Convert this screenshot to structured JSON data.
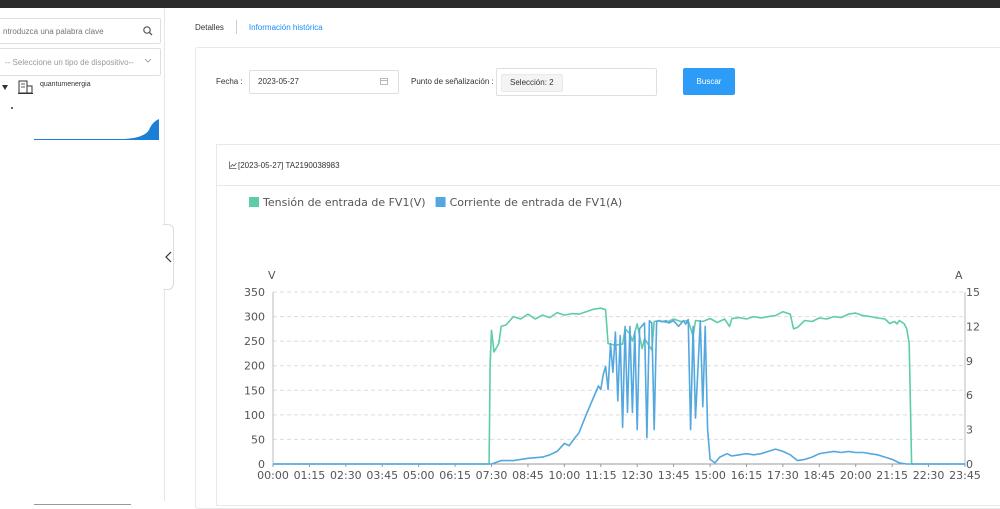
{
  "sidebar": {
    "search_placeholder": "ntroduzca una palabra clave",
    "device_type_placeholder": "-- Seleccione un tipo de dispositivo--",
    "tree_node": "quantumenergia"
  },
  "tabs": {
    "details": "Detalles",
    "history": "Información histórica"
  },
  "filters": {
    "date_label": "Fecha :",
    "date_value": "2023-05-27",
    "point_label": "Punto de señalización :",
    "selection_tag": "Selección: 2",
    "search_button": "Buscar"
  },
  "chart_header": {
    "title": "[2023-05-27] TA2190038983"
  },
  "colors": {
    "accent": "#2d9cf7",
    "link": "#1a8cff",
    "series_voltage": "#5ecca8",
    "series_current": "#53a8df"
  },
  "chart_data": {
    "type": "line",
    "legend": [
      {
        "name": "Tensión de entrada de FV1(V)",
        "color": "#5ecca8"
      },
      {
        "name": "Corriente de entrada de FV1(A)",
        "color": "#53a8df"
      }
    ],
    "legend_position": "top-left",
    "x_ticks": [
      "00:00",
      "01:15",
      "02:30",
      "03:45",
      "05:00",
      "06:15",
      "07:30",
      "08:45",
      "10:00",
      "11:15",
      "12:30",
      "13:45",
      "15:00",
      "16:15",
      "17:30",
      "18:45",
      "20:00",
      "21:15",
      "22:30",
      "23:45"
    ],
    "y_left": {
      "label": "V",
      "ticks": [
        0,
        50,
        100,
        150,
        200,
        250,
        300,
        350
      ],
      "range": [
        0,
        350
      ]
    },
    "y_right": {
      "label": "A",
      "ticks": [
        0,
        3,
        6,
        9,
        12,
        15
      ],
      "range": [
        0,
        15
      ]
    },
    "grid": "horizontal dashed",
    "series": [
      {
        "name": "Tensión de entrada de FV1(V)",
        "axis": "left",
        "points": [
          [
            "00:00",
            0
          ],
          [
            "07:25",
            0
          ],
          [
            "07:27",
            200
          ],
          [
            "07:30",
            272
          ],
          [
            "07:35",
            228
          ],
          [
            "07:45",
            245
          ],
          [
            "07:50",
            280
          ],
          [
            "08:00",
            283
          ],
          [
            "08:15",
            300
          ],
          [
            "08:30",
            295
          ],
          [
            "08:45",
            305
          ],
          [
            "09:00",
            295
          ],
          [
            "09:15",
            303
          ],
          [
            "09:30",
            298
          ],
          [
            "09:45",
            308
          ],
          [
            "10:00",
            303
          ],
          [
            "10:15",
            306
          ],
          [
            "10:30",
            305
          ],
          [
            "10:45",
            310
          ],
          [
            "11:00",
            315
          ],
          [
            "11:15",
            317
          ],
          [
            "11:25",
            314
          ],
          [
            "11:30",
            245
          ],
          [
            "11:45",
            242
          ],
          [
            "12:00",
            244
          ],
          [
            "12:05",
            275
          ],
          [
            "12:15",
            265
          ],
          [
            "12:20",
            250
          ],
          [
            "12:30",
            285
          ],
          [
            "12:40",
            235
          ],
          [
            "12:45",
            255
          ],
          [
            "13:00",
            232
          ],
          [
            "13:05",
            290
          ],
          [
            "13:15",
            292
          ],
          [
            "13:30",
            288
          ],
          [
            "13:45",
            295
          ],
          [
            "14:00",
            290
          ],
          [
            "14:15",
            292
          ],
          [
            "14:25",
            260
          ],
          [
            "14:30",
            292
          ],
          [
            "14:45",
            290
          ],
          [
            "15:00",
            296
          ],
          [
            "15:15",
            288
          ],
          [
            "15:30",
            295
          ],
          [
            "15:40",
            280
          ],
          [
            "15:45",
            296
          ],
          [
            "16:00",
            298
          ],
          [
            "16:15",
            295
          ],
          [
            "16:30",
            300
          ],
          [
            "16:45",
            297
          ],
          [
            "17:00",
            300
          ],
          [
            "17:15",
            302
          ],
          [
            "17:30",
            310
          ],
          [
            "17:45",
            305
          ],
          [
            "17:52",
            275
          ],
          [
            "18:00",
            278
          ],
          [
            "18:15",
            292
          ],
          [
            "18:30",
            290
          ],
          [
            "18:45",
            297
          ],
          [
            "19:00",
            295
          ],
          [
            "19:15",
            300
          ],
          [
            "19:30",
            298
          ],
          [
            "19:45",
            305
          ],
          [
            "20:00",
            307
          ],
          [
            "20:15",
            302
          ],
          [
            "20:30",
            300
          ],
          [
            "20:45",
            297
          ],
          [
            "21:00",
            295
          ],
          [
            "21:10",
            286
          ],
          [
            "21:20",
            290
          ],
          [
            "21:25",
            285
          ],
          [
            "21:30",
            292
          ],
          [
            "21:40",
            285
          ],
          [
            "21:45",
            275
          ],
          [
            "21:50",
            245
          ],
          [
            "21:55",
            0
          ],
          [
            "23:45",
            0
          ]
        ]
      },
      {
        "name": "Corriente de entrada de FV1(A)",
        "axis": "right",
        "points": [
          [
            "00:00",
            0
          ],
          [
            "07:30",
            0
          ],
          [
            "07:50",
            0.3
          ],
          [
            "08:15",
            0.3
          ],
          [
            "08:45",
            0.5
          ],
          [
            "09:15",
            0.6
          ],
          [
            "09:30",
            0.8
          ],
          [
            "09:45",
            1.1
          ],
          [
            "10:00",
            1.8
          ],
          [
            "10:10",
            1.6
          ],
          [
            "10:20",
            2.2
          ],
          [
            "10:30",
            2.7
          ],
          [
            "10:45",
            4.3
          ],
          [
            "11:00",
            5.8
          ],
          [
            "11:10",
            6.8
          ],
          [
            "11:15",
            6.5
          ],
          [
            "11:20",
            7.8
          ],
          [
            "11:25",
            8.5
          ],
          [
            "11:30",
            6.5
          ],
          [
            "11:35",
            10.5
          ],
          [
            "11:40",
            8.0
          ],
          [
            "11:45",
            11.5
          ],
          [
            "11:50",
            5.5
          ],
          [
            "11:55",
            11.2
          ],
          [
            "12:00",
            3.2
          ],
          [
            "12:05",
            12.0
          ],
          [
            "12:10",
            4.5
          ],
          [
            "12:15",
            12.0
          ],
          [
            "12:20",
            4.5
          ],
          [
            "12:25",
            11.5
          ],
          [
            "12:30",
            3.0
          ],
          [
            "12:35",
            11.8
          ],
          [
            "12:45",
            12.3
          ],
          [
            "12:50",
            2.3
          ],
          [
            "12:55",
            12.5
          ],
          [
            "13:00",
            12.3
          ],
          [
            "13:05",
            3.0
          ],
          [
            "13:10",
            12.4
          ],
          [
            "13:15",
            12.5
          ],
          [
            "13:20",
            12.4
          ],
          [
            "13:30",
            12.5
          ],
          [
            "13:35",
            12.3
          ],
          [
            "13:45",
            12.5
          ],
          [
            "13:55",
            12.0
          ],
          [
            "14:05",
            12.5
          ],
          [
            "14:10",
            12.2
          ],
          [
            "14:15",
            12.6
          ],
          [
            "14:20",
            3.0
          ],
          [
            "14:25",
            12.0
          ],
          [
            "14:30",
            4.0
          ],
          [
            "14:40",
            12.5
          ],
          [
            "14:45",
            5.0
          ],
          [
            "14:50",
            12.0
          ],
          [
            "14:55",
            3.0
          ],
          [
            "15:00",
            0.4
          ],
          [
            "15:10",
            0.1
          ],
          [
            "15:20",
            0.6
          ],
          [
            "15:35",
            0.9
          ],
          [
            "15:45",
            0.7
          ],
          [
            "16:00",
            0.8
          ],
          [
            "16:15",
            0.9
          ],
          [
            "16:30",
            0.8
          ],
          [
            "16:45",
            0.9
          ],
          [
            "17:00",
            1.1
          ],
          [
            "17:15",
            1.3
          ],
          [
            "17:30",
            1.1
          ],
          [
            "17:45",
            0.8
          ],
          [
            "18:00",
            0.3
          ],
          [
            "18:15",
            0.4
          ],
          [
            "18:30",
            0.6
          ],
          [
            "18:45",
            0.9
          ],
          [
            "19:00",
            1.0
          ],
          [
            "19:15",
            1.1
          ],
          [
            "19:30",
            1.0
          ],
          [
            "19:45",
            1.1
          ],
          [
            "20:00",
            1.0
          ],
          [
            "20:15",
            1.0
          ],
          [
            "20:30",
            0.9
          ],
          [
            "20:45",
            0.8
          ],
          [
            "21:00",
            0.6
          ],
          [
            "21:15",
            0.4
          ],
          [
            "21:30",
            0.1
          ],
          [
            "21:45",
            0.0
          ],
          [
            "23:45",
            0
          ]
        ]
      }
    ]
  }
}
